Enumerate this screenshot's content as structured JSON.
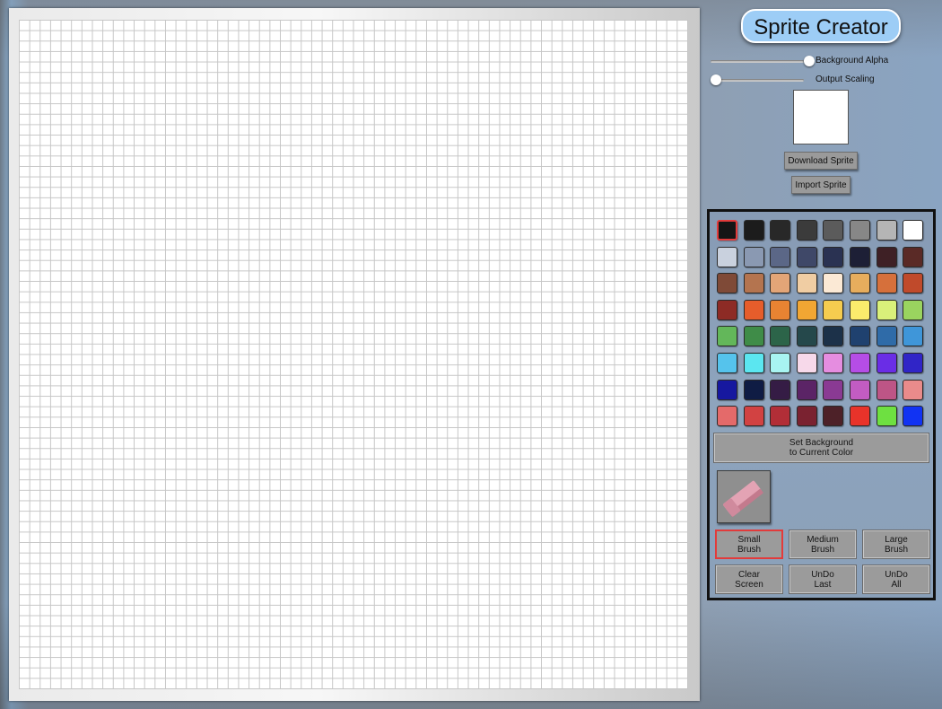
{
  "app": {
    "title": "Sprite Creator"
  },
  "sliders": [
    {
      "label": "Background Alpha",
      "value": 1.0
    },
    {
      "label": "Output Scaling",
      "value": 0.0
    }
  ],
  "buttons": {
    "download": "Download Sprite",
    "import": "Import Sprite"
  },
  "palette": {
    "selected_index": 0,
    "colors": [
      "#151515",
      "#1c1c1c",
      "#282828",
      "#3b3b3b",
      "#5b5b5b",
      "#878787",
      "#b5b5b5",
      "#ffffff",
      "#c9d1de",
      "#8a99b2",
      "#5b6787",
      "#3f4868",
      "#2a3252",
      "#1d1f36",
      "#3e2025",
      "#5a2a26",
      "#7f4a37",
      "#b4744f",
      "#e3a577",
      "#f0cda3",
      "#fbe9d5",
      "#e7ad5d",
      "#d6703b",
      "#c04a2b",
      "#8d2b25",
      "#e65d2b",
      "#e88332",
      "#f1a633",
      "#f6cc4f",
      "#fbec6c",
      "#d9f07a",
      "#9ad45f",
      "#63b75a",
      "#3f8c48",
      "#2c6449",
      "#25484b",
      "#1c3149",
      "#1f416f",
      "#2f6ba8",
      "#3f96d9",
      "#55c3ec",
      "#5be6f0",
      "#a8f4f1",
      "#f7d9ea",
      "#e58de0",
      "#b54de6",
      "#6a2de6",
      "#3025c7",
      "#16189f",
      "#0f1c44",
      "#351c45",
      "#5b2466",
      "#8a3a93",
      "#c25cc2",
      "#bd5586",
      "#e98b8b",
      "#e46a6a",
      "#d24242",
      "#b22e37",
      "#7a2230",
      "#4d2128",
      "#e8332a",
      "#6ee041",
      "#1133f3"
    ],
    "set_background_line1": "Set Background",
    "set_background_line2": "to Current Color"
  },
  "tools": {
    "eraser_icon": "eraser-icon",
    "selected_brush": "small",
    "brushes": [
      {
        "line1": "Small",
        "line2": "Brush"
      },
      {
        "line1": "Medium",
        "line2": "Brush"
      },
      {
        "line1": "Large",
        "line2": "Brush"
      }
    ],
    "actions": [
      {
        "line1": "Clear",
        "line2": "Screen"
      },
      {
        "line1": "UnDo",
        "line2": "Last"
      },
      {
        "line1": "UnDo",
        "line2": "All"
      }
    ]
  },
  "preview": {
    "background": "#ffffff"
  },
  "accent": {
    "selection": "#e23b3b",
    "title_bg": "#9dcdf6"
  }
}
